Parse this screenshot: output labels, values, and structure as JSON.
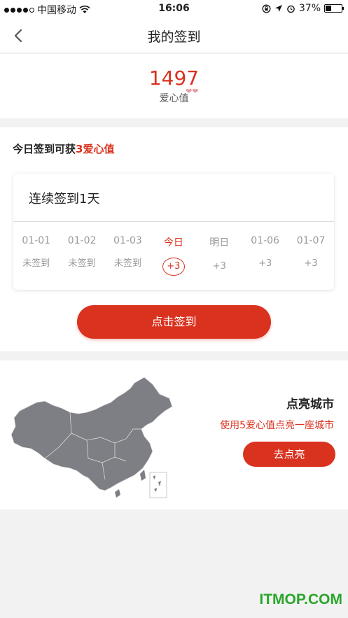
{
  "status_bar": {
    "carrier": "中国移动",
    "time": "16:06",
    "battery_text": "37%",
    "battery_level": 0.37
  },
  "nav": {
    "title": "我的签到",
    "back_icon": "chevron-left-icon"
  },
  "score": {
    "value": "1497",
    "label": "爱心值"
  },
  "signin": {
    "tip_prefix": "今日签到可获",
    "tip_highlight": "3爱心值",
    "streak_text": "连续签到1天",
    "days": [
      {
        "date": "01-01",
        "status": "未签到"
      },
      {
        "date": "01-02",
        "status": "未签到"
      },
      {
        "date": "01-03",
        "status": "未签到"
      },
      {
        "date": "今日",
        "status": "+3"
      },
      {
        "date": "明日",
        "status": "+3"
      },
      {
        "date": "01-06",
        "status": "+3"
      },
      {
        "date": "01-07",
        "status": "+3"
      }
    ],
    "button_label": "点击签到"
  },
  "city": {
    "title": "点亮城市",
    "subtitle": "使用5爱心值点亮一座城市",
    "button_label": "去点亮"
  },
  "watermark": "ITMOP.COM",
  "colors": {
    "accent": "#d9321f",
    "background": "#f2f2f2",
    "map": "#7d7f84"
  }
}
